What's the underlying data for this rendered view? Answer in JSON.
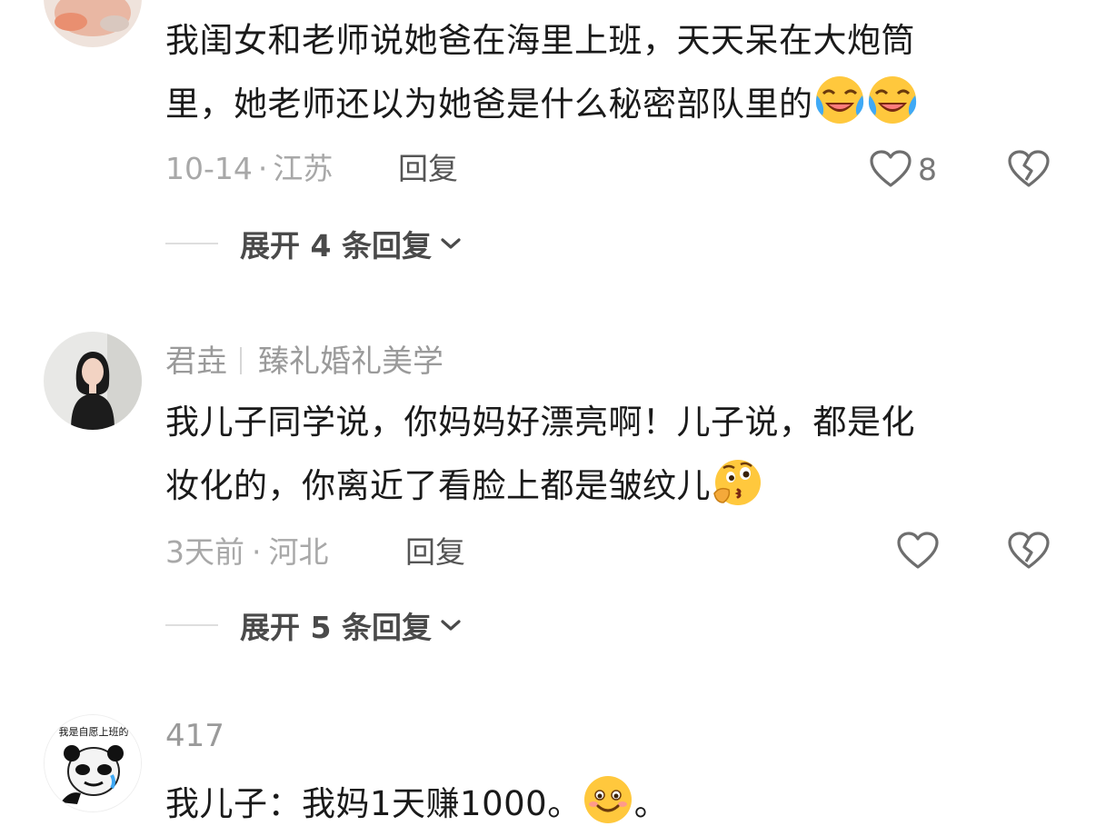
{
  "comments": [
    {
      "username": "",
      "text_line1": "我闺女和老师说她爸在海里上班，天天呆在大炮筒",
      "text_line2": "里，她老师还以为她爸是什么秘密部队里的",
      "emojis": [
        "laugh-cry-emoji",
        "laugh-cry-emoji"
      ],
      "date": "10-14",
      "location": "江苏",
      "reply_label": "回复",
      "like_count": "8",
      "expand_label": "展开 4 条回复"
    },
    {
      "username": "君垚",
      "username_tag": "臻礼婚礼美学",
      "text_line1": "我儿子同学说，你妈妈好漂亮啊！儿子说，都是化",
      "text_line2": "妆化的，你离近了看脸上都是皱纹儿",
      "emojis": [
        "thinking-kiss-emoji"
      ],
      "date": "3天前",
      "location": "河北",
      "reply_label": "回复",
      "like_count": "",
      "expand_label": "展开 5 条回复"
    },
    {
      "username": "417",
      "avatar_caption": "我是自愿上班的",
      "text_line1": "我儿子：我妈1天赚1000。",
      "text_suffix": "。",
      "emojis": [
        "smile-emoji"
      ]
    }
  ],
  "meta_separator": "·",
  "colors": {
    "text": "#1a1a1a",
    "meta": "#a8a8a8",
    "username": "#9a9a9a",
    "reply": "#555555"
  }
}
